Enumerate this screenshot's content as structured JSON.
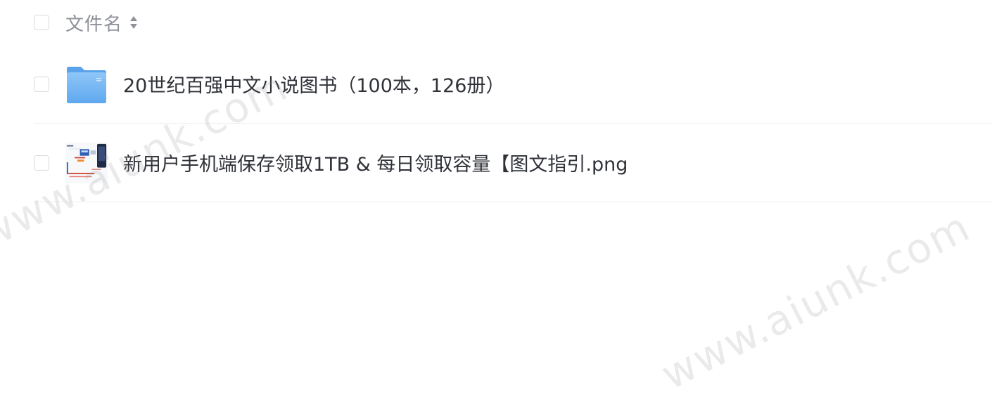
{
  "header": {
    "column_label": "文件名"
  },
  "files": [
    {
      "name": "20世纪百强中文小说图书（100本，126册）",
      "type": "folder",
      "icon": "folder-icon"
    },
    {
      "name": "新用户手机端保存领取1TB & 每日领取容量【图文指引.png",
      "type": "image",
      "icon": "image-thumbnail"
    }
  ],
  "watermark": {
    "text": "www.aiunk.com"
  },
  "colors": {
    "folder": "#6fb3f3",
    "text": "#2f3238",
    "header_text": "#8e9199",
    "border": "#eceef1"
  }
}
